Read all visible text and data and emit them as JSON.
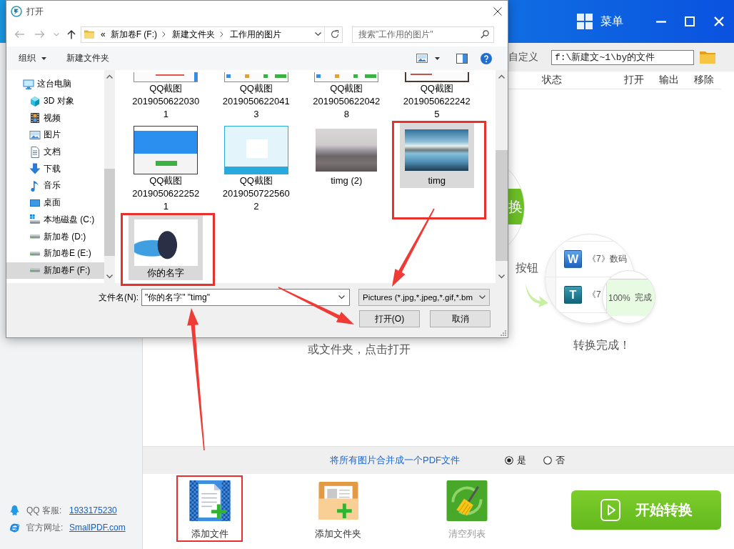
{
  "app": {
    "menu": "菜单",
    "output": {
      "option": "自定义",
      "path": "f:\\新建文~1\\by的文件"
    },
    "columns": [
      "状态",
      "打开",
      "输出",
      "移除"
    ],
    "guide": {
      "step1": "或文件夹，点击打开",
      "step2": {
        "button_text": "换",
        "caption": "按钮"
      },
      "step3": {
        "rows": [
          {
            "kind": "word",
            "icon": "W",
            "title": "《7》数码"
          },
          {
            "kind": "text",
            "icon": "T",
            "title": "《7"
          }
        ],
        "progress": "100%",
        "status": "完成",
        "caption": "转换完成！"
      }
    },
    "merge": {
      "label": "将所有图片合并成一个PDF文件",
      "options": [
        {
          "label": "是",
          "selected": true
        },
        {
          "label": "否",
          "selected": false
        }
      ]
    },
    "actions": [
      {
        "kind": "add-file",
        "label": "添加文件",
        "disabled": false,
        "highlighted": true
      },
      {
        "kind": "add-folder",
        "label": "添加文件夹",
        "disabled": false,
        "highlighted": false
      },
      {
        "kind": "clear",
        "label": "清空列表",
        "disabled": true,
        "highlighted": false
      }
    ],
    "start": "开始转换",
    "contacts": [
      {
        "kind": "qq",
        "label": "QQ 客服:",
        "link": "1933175230"
      },
      {
        "kind": "web",
        "label": "官方网址:",
        "link": "SmallPDF.com"
      }
    ]
  },
  "dialog": {
    "title": "打开",
    "address": {
      "overflow": "«",
      "crumbs": [
        "新加卷F (F:)",
        "新建文件夹",
        "工作用的图片"
      ]
    },
    "search": {
      "placeholder": "搜索\"工作用的图片\""
    },
    "toolbar": {
      "organize": "组织",
      "new_folder": "新建文件夹"
    },
    "nav": [
      {
        "kind": "pc",
        "label": "这台电脑",
        "selected": false,
        "children": [
          {
            "kind": "objects",
            "label": "3D 对象",
            "selected": false
          },
          {
            "kind": "video",
            "label": "视频",
            "selected": false
          },
          {
            "kind": "pictures",
            "label": "图片",
            "selected": false
          },
          {
            "kind": "documents",
            "label": "文档",
            "selected": false
          },
          {
            "kind": "downloads",
            "label": "下载",
            "selected": false
          },
          {
            "kind": "music",
            "label": "音乐",
            "selected": false
          },
          {
            "kind": "desktop",
            "label": "桌面",
            "selected": false
          },
          {
            "kind": "system-drive",
            "label": "本地磁盘 (C:)",
            "selected": false
          },
          {
            "kind": "drive",
            "label": "新加卷 (D:)",
            "selected": false
          },
          {
            "kind": "drive",
            "label": "新加卷E (E:)",
            "selected": false
          },
          {
            "kind": "drive",
            "label": "新加卷F (F:)",
            "selected": true
          }
        ]
      }
    ],
    "files": {
      "rows": [
        {
          "kind": "clipped",
          "items": [
            {
              "kind": "screenshot",
              "name_lines": [
                "QQ截图",
                "2019050622030",
                "1"
              ],
              "selected": false,
              "highlighted": false
            },
            {
              "kind": "screenshot",
              "name_lines": [
                "QQ截图",
                "2019050622041",
                "3"
              ],
              "selected": false,
              "highlighted": false
            },
            {
              "kind": "screenshot",
              "name_lines": [
                "QQ截图",
                "2019050622042",
                "8"
              ],
              "selected": false,
              "highlighted": false
            },
            {
              "kind": "screenshot",
              "name_lines": [
                "QQ截图",
                "2019050622242",
                "5"
              ],
              "selected": false,
              "highlighted": false
            }
          ]
        },
        {
          "kind": "full",
          "items": [
            {
              "kind": "screenshot",
              "name_lines": [
                "QQ截图",
                "2019050622252",
                "1"
              ],
              "selected": false,
              "highlighted": false
            },
            {
              "kind": "screenshot",
              "name_lines": [
                "QQ截图",
                "2019050722560",
                "2"
              ],
              "selected": false,
              "highlighted": false
            },
            {
              "kind": "photo",
              "name_lines": [
                "timg (2)"
              ],
              "selected": false,
              "highlighted": false
            },
            {
              "kind": "photo",
              "name_lines": [
                "timg"
              ],
              "selected": true,
              "highlighted": true
            }
          ]
        },
        {
          "kind": "full",
          "items": [
            {
              "kind": "picture",
              "name_lines": [
                "你的名字"
              ],
              "selected": true,
              "highlighted": true
            }
          ]
        }
      ]
    },
    "filename": {
      "label": "文件名(N):",
      "value": "\"你的名字\" \"timg\""
    },
    "filetype": "Pictures (*.jpg,*.jpeg,*.gif,*.bm",
    "buttons": [
      "打开(O)",
      "取消"
    ]
  }
}
